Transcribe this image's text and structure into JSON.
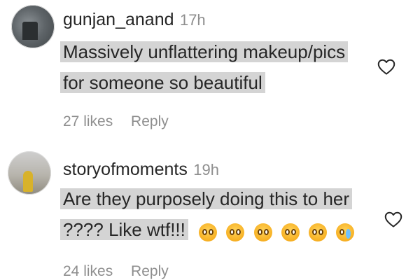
{
  "comments": [
    {
      "username": "gunjan_anand",
      "time": "17h",
      "lines": [
        "Massively unflattering makeup/pics",
        "for someone so beautiful"
      ],
      "likes": "27 likes",
      "reply": "Reply",
      "like_icon": "heart-outline-icon"
    },
    {
      "username": "storyofmoments",
      "time": "19h",
      "lines": [
        "Are they purposely doing this to her",
        "???? Like wtf!!!"
      ],
      "emojis": [
        "anguished-face-icon",
        "anguished-face-icon",
        "anguished-face-icon",
        "anguished-face-icon",
        "anguished-face-icon",
        "loudly-crying-face-icon"
      ],
      "likes": "24 likes",
      "reply": "Reply",
      "like_icon": "heart-outline-icon"
    }
  ],
  "colors": {
    "text": "#262626",
    "muted": "#8e8e8e",
    "highlight": "#d4d4d4",
    "emoji_yellow": "#f7b023"
  }
}
